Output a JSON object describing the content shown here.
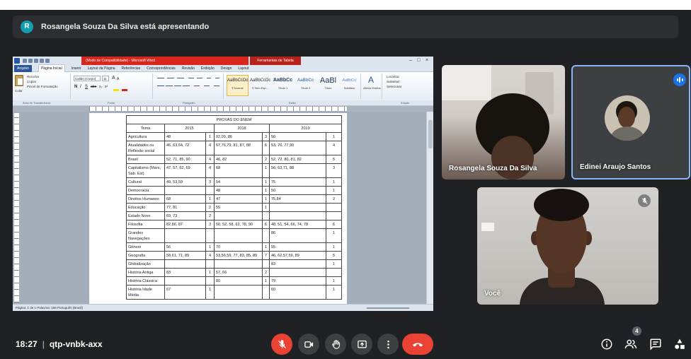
{
  "meeting": {
    "presenter_initial": "R",
    "presenting_banner": "Rosangela Souza Da Silva está apresentando",
    "time": "18:27",
    "separator": "|",
    "meeting_code": "qtp-vnbk-axx",
    "participant_count": "4"
  },
  "tiles": [
    {
      "name": "Rosangela Souza Da Silva",
      "camera": "on"
    },
    {
      "name": "Edinei Araujo Santos",
      "camera": "off",
      "speaking": true
    },
    {
      "name": "Você",
      "camera": "on",
      "muted": true
    }
  ],
  "controls": {
    "center": [
      "mic-off-icon",
      "camera-icon",
      "raise-hand-icon",
      "present-screen-icon",
      "more-options-icon",
      "end-call-icon"
    ],
    "right": [
      "meeting-details-icon",
      "people-icon",
      "chat-icon",
      "activities-icon"
    ]
  },
  "word": {
    "title": "(Modo de Compatibilidade) - Microsoft Word",
    "contextual_tab": "Ferramentas de Tabela",
    "window_controls": [
      "–",
      "□",
      "×"
    ],
    "tabs": [
      "Arquivo",
      "Página Inicial",
      "Inserir",
      "Layout da Página",
      "Referências",
      "Correspondências",
      "Revisão",
      "Exibição",
      "Design",
      "Layout"
    ],
    "clipboard": {
      "paste": "Colar",
      "cut": "Recortar",
      "copy": "Copiar",
      "format_painter": "Pincel de Formatação"
    },
    "font": {
      "name": "Calibri (Corpo)",
      "size": "11",
      "buttons": [
        "N",
        "I",
        "S",
        "abe",
        "x₂",
        "x²",
        "A",
        "A"
      ]
    },
    "styles": [
      {
        "sample": "AaBbCcDd",
        "label": "¶ Normal"
      },
      {
        "sample": "AaBbCcDc",
        "label": "¶ Sem Esp..."
      },
      {
        "sample": "AaBbCc",
        "label": "Título 1"
      },
      {
        "sample": "AaBbCc",
        "label": "Título 2"
      },
      {
        "sample": "AaBl",
        "label": "Título"
      },
      {
        "sample": "AaBbCcI",
        "label": "Subtítulo"
      }
    ],
    "change_styles": "Alterar Estilos",
    "editing": [
      "Localizar",
      "Substituir",
      "Selecionar"
    ],
    "group_labels": [
      "Área de Transferência",
      "Fonte",
      "Parágrafo",
      "Estilo",
      "Edição"
    ],
    "status": "Página: 1 de 1    Palavras: 156    Português (Brasil)"
  },
  "document": {
    "title": "PROVAS DO ENEM",
    "headers": [
      "Tema",
      "2015",
      "2018",
      "2019"
    ],
    "rows": [
      [
        "Agricultura",
        "48",
        "1",
        "02,09, 86",
        "3",
        "56",
        "1"
      ],
      [
        "Atualidades ou Reflexão social",
        "46, 63,64, 72",
        "4",
        "67,76,79, 81, 87, 88",
        "6",
        "53, 76, 77,90",
        "4"
      ],
      [
        "Brasil",
        "52, 71, 85, 90",
        "4",
        "46, 82",
        "2",
        "52, 72, 80, 81, 82",
        "5"
      ],
      [
        "Capitalismo (Marx, Sab. Est)",
        "47, 57, 62, 69",
        "4",
        "68",
        "1",
        "56, 63,71, 88",
        "3"
      ],
      [
        "Cultural",
        "49, 53,59",
        "3",
        "54",
        "1",
        "75",
        "1"
      ],
      [
        "Democracia",
        "",
        "",
        "48",
        "1",
        "50",
        "1"
      ],
      [
        "Direitos Humanos",
        "68",
        "1",
        "47",
        "1",
        "75,84",
        "2"
      ],
      [
        "Educação",
        "77, 81",
        "2",
        "55",
        "1",
        "",
        ""
      ],
      [
        "Estado Novo",
        "69, 73",
        "2",
        "",
        "",
        "",
        ""
      ],
      [
        "Filosofia",
        "82,86, 87",
        "3",
        "50, 52, 58, 62, 78, 90",
        "6",
        "48, 51, 54, 66, 74, 78",
        "6"
      ],
      [
        "Grandes Navegações",
        "",
        "",
        "",
        "",
        "86",
        "1"
      ],
      [
        "Gênero",
        "56",
        "1",
        "70",
        "1",
        "55",
        "1"
      ],
      [
        "Geografia",
        "58,61, 71, 89",
        "4",
        "53,56,59, 77, 83, 85, 89",
        "7",
        "46, 62,57,59, 89",
        "5"
      ],
      [
        "Globalização",
        "",
        "",
        "",
        "",
        "83",
        "1"
      ],
      [
        "História Antiga",
        "83",
        "1",
        "57, 66",
        "2",
        "",
        ""
      ],
      [
        "História Clássica",
        "",
        "",
        "80",
        "1",
        "79",
        "1"
      ],
      [
        "História Idade Média",
        "67",
        "1",
        "",
        "",
        "60",
        "1"
      ]
    ]
  },
  "colors": {
    "meet_background": "#202124",
    "end_call": "#ea4335",
    "speaking_border": "#8ab4f8",
    "speaking_indicator": "#1a73e8",
    "presenter_avatar": "#129eaf",
    "word_title_red": "#d9261c",
    "word_file_tab": "#2a5699"
  }
}
